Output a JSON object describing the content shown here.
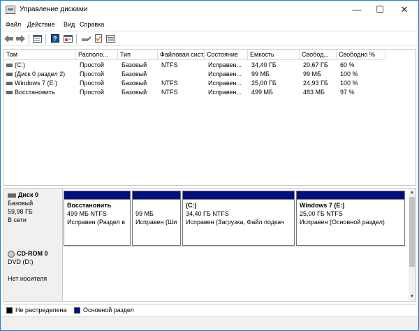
{
  "window": {
    "title": "Управление дисками"
  },
  "menu": [
    "Файл",
    "Действие",
    "Вид",
    "Справка"
  ],
  "volumes": {
    "headers": [
      "Том",
      "Располо...",
      "Тип",
      "Файловая сист...",
      "Состояние",
      "Емкость",
      "Свобод...",
      "Свободно %"
    ],
    "rows": [
      [
        "(C:)",
        "Простой",
        "Базовый",
        "NTFS",
        "Исправен...",
        "34,40 ГБ",
        "20,67 ГБ",
        "60 %"
      ],
      [
        "(Диск 0 раздел 2)",
        "Простой",
        "Базовый",
        "",
        "Исправен...",
        "99 МБ",
        "99 МБ",
        "100 %"
      ],
      [
        "Windows 7  (E:)",
        "Простой",
        "Базовый",
        "NTFS",
        "Исправен...",
        "25,00 ГБ",
        "24,93 ГБ",
        "100 %"
      ],
      [
        "Восстановить",
        "Простой",
        "Базовый",
        "NTFS",
        "Исправен...",
        "499 МБ",
        "483 МБ",
        "97 %"
      ]
    ]
  },
  "disk0": {
    "name": "Диск 0",
    "type": "Базовый",
    "size": "59,98 ГБ",
    "status": "В сети",
    "partitions": [
      {
        "title": "Восстановить",
        "info": "499 МБ NTFS",
        "status": "Исправен (Раздел в"
      },
      {
        "title": "",
        "info": "99 МБ",
        "status": "Исправен (Ши"
      },
      {
        "title": "(C:)",
        "info": "34,40 ГБ NTFS",
        "status": "Исправен (Загрузка, Файл подкач"
      },
      {
        "title": "Windows 7   (E:)",
        "info": "25,00 ГБ NTFS",
        "status": "Исправен (Основной раздел)"
      }
    ]
  },
  "cdrom0": {
    "name": "CD-ROM 0",
    "drive": "DVD (D:)",
    "status": "Нет носителя"
  },
  "legend": [
    {
      "label": "Не распределена",
      "color": "#000000"
    },
    {
      "label": "Основной раздел",
      "color": "#000f80"
    }
  ]
}
